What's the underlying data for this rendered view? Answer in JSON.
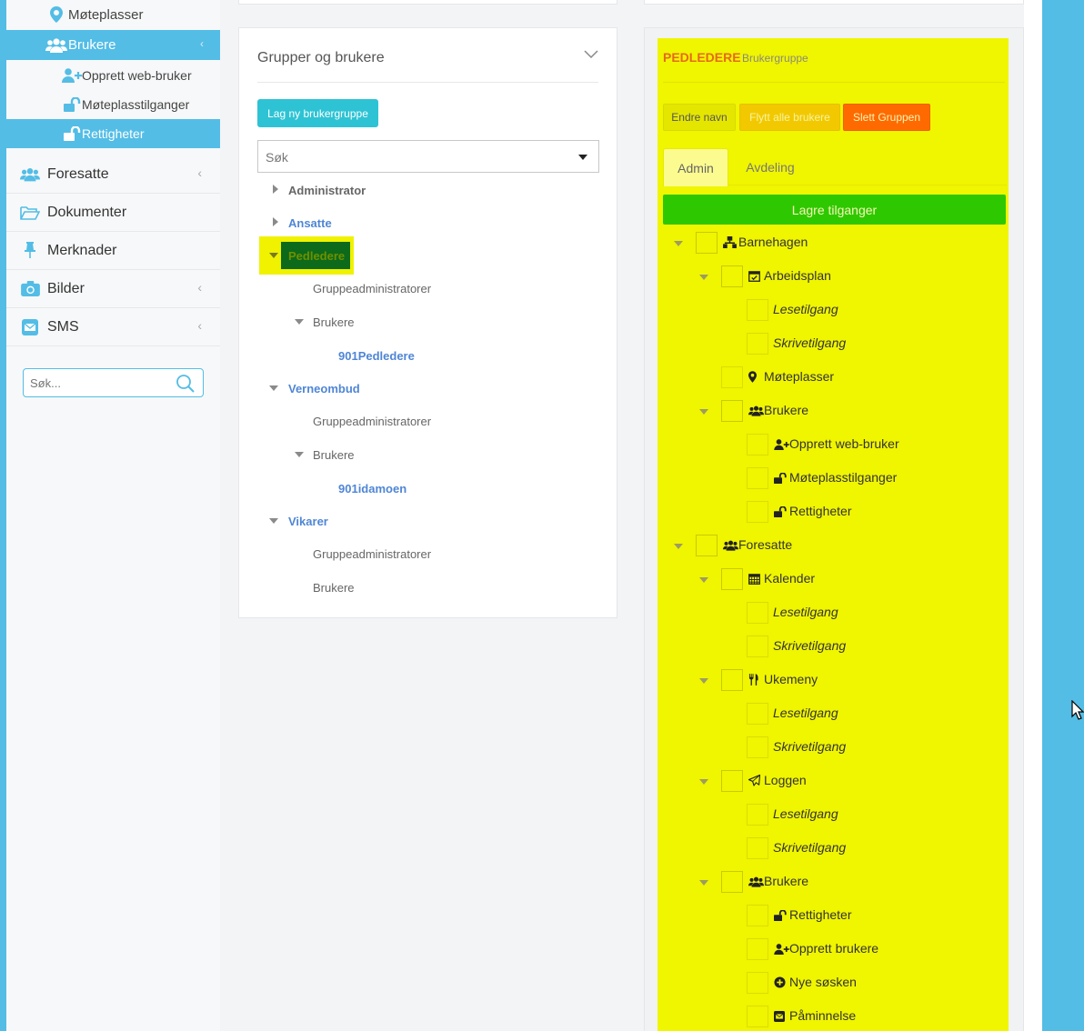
{
  "sidebar": {
    "sub_top": [
      {
        "label": "Møteplasser",
        "icon": "map-pin-icon"
      },
      {
        "label": "Brukere",
        "icon": "users-icon",
        "active": true
      }
    ],
    "sub_brukere": [
      {
        "label": "Opprett web-bruker",
        "icon": "user-plus-icon"
      },
      {
        "label": "Møteplasstilganger",
        "icon": "unlock-icon"
      },
      {
        "label": "Rettigheter",
        "icon": "unlock-icon",
        "active": true
      }
    ],
    "main": [
      {
        "label": "Foresatte",
        "icon": "users-icon",
        "chevron": true
      },
      {
        "label": "Dokumenter",
        "icon": "folder-open-icon",
        "chevron": false
      },
      {
        "label": "Merknader",
        "icon": "pushpin-icon",
        "chevron": false
      },
      {
        "label": "Bilder",
        "icon": "camera-icon",
        "chevron": true
      },
      {
        "label": "SMS",
        "icon": "envelope-icon",
        "chevron": true
      }
    ],
    "search_placeholder": "Søk..."
  },
  "groups": {
    "title": "Grupper og brukere",
    "new_group_button": "Lag ny brukergruppe",
    "select_placeholder": "Søk",
    "tree": {
      "administrator": "Administrator",
      "ansatte": "Ansatte",
      "pedledere": "Pedledere",
      "pedledere_admins": "Gruppeadministratorer",
      "pedledere_users": "Brukere",
      "pedledere_user1": "901Pedledere",
      "verneombud": "Verneombud",
      "verneombud_admins": "Gruppeadministratorer",
      "verneombud_users": "Brukere",
      "verneombud_user1": "901idamoen",
      "vikarer": "Vikarer",
      "vikarer_admins": "Gruppeadministratorer",
      "vikarer_users": "Brukere"
    }
  },
  "group_detail": {
    "name": "PEDLEDERE",
    "type": "Brukergruppe",
    "buttons": {
      "rename": "Endre navn",
      "move_all": "Flytt alle brukere",
      "delete": "Slett Gruppen"
    },
    "tabs": [
      "Admin",
      "Avdeling"
    ],
    "save_button": "Lagre tilganger",
    "colors": {
      "highlight": "#f0f500",
      "save": "#2ec800",
      "delete": "#ff6a00",
      "move": "#f2c900",
      "title": "#e66a1a"
    }
  },
  "permissions": [
    {
      "label": "Barnehagen",
      "icon": "sitemap-icon",
      "perm": false
    },
    {
      "label": "Arbeidsplan",
      "icon": "calendar-check-icon",
      "perm": false
    },
    {
      "label": "Lesetilgang",
      "icon": "",
      "perm": true
    },
    {
      "label": "Skrivetilgang",
      "icon": "",
      "perm": true
    },
    {
      "label": "Møteplasser",
      "icon": "map-pin-icon",
      "perm": false
    },
    {
      "label": "Brukere",
      "icon": "users-icon",
      "perm": false
    },
    {
      "label": "Opprett web-bruker",
      "icon": "user-plus-icon",
      "perm": false
    },
    {
      "label": "Møteplasstilganger",
      "icon": "unlock-icon",
      "perm": false
    },
    {
      "label": "Rettigheter",
      "icon": "unlock-icon",
      "perm": false
    },
    {
      "label": "Foresatte",
      "icon": "users-icon",
      "perm": false
    },
    {
      "label": "Kalender",
      "icon": "calendar-icon",
      "perm": false
    },
    {
      "label": "Lesetilgang",
      "icon": "",
      "perm": true
    },
    {
      "label": "Skrivetilgang",
      "icon": "",
      "perm": true
    },
    {
      "label": "Ukemeny",
      "icon": "cutlery-icon",
      "perm": false
    },
    {
      "label": "Lesetilgang",
      "icon": "",
      "perm": true
    },
    {
      "label": "Skrivetilgang",
      "icon": "",
      "perm": true
    },
    {
      "label": "Loggen",
      "icon": "paper-plane-icon",
      "perm": false
    },
    {
      "label": "Lesetilgang",
      "icon": "",
      "perm": true
    },
    {
      "label": "Skrivetilgang",
      "icon": "",
      "perm": true
    },
    {
      "label": "Brukere",
      "icon": "users-icon",
      "perm": false
    },
    {
      "label": "Rettigheter",
      "icon": "unlock-icon",
      "perm": false
    },
    {
      "label": "Opprett brukere",
      "icon": "user-plus-icon",
      "perm": false
    },
    {
      "label": "Nye søsken",
      "icon": "plus-circle-icon",
      "perm": false
    },
    {
      "label": "Påminnelse",
      "icon": "envelope-square-icon",
      "perm": false
    }
  ]
}
